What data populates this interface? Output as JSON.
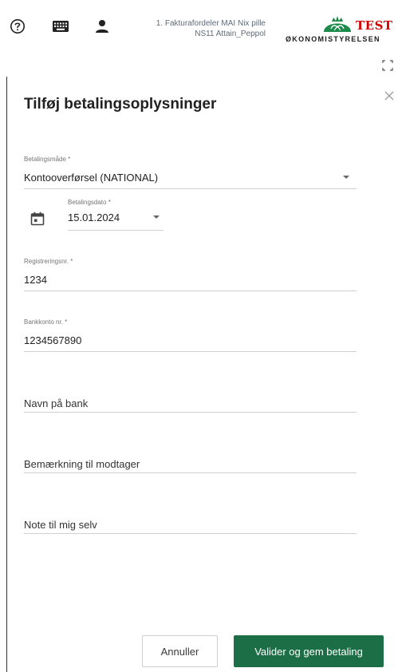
{
  "header": {
    "user_line1": "1. Fakturafordeler MAI Nix pille",
    "user_line2": "NS11 Attain_Peppol",
    "logo_badge": "TEST",
    "logo_name": "ØKONOMISTYRELSEN",
    "icons": [
      "help-icon",
      "keyboard-icon",
      "person-icon"
    ]
  },
  "dialog": {
    "title": "Tilføj betalingsoplysninger",
    "fields": {
      "payment_method": {
        "label": "Betalingsmåde *",
        "value": "Kontooverførsel (NATIONAL)"
      },
      "payment_date": {
        "label": "Betalingsdato *",
        "value": "15.01.2024"
      },
      "registration_no": {
        "label": "Registreringsnr. *",
        "value": "1234"
      },
      "account_no": {
        "label": "Bankkonto nr. *",
        "value": "1234567890"
      },
      "bank_name": {
        "placeholder": "Navn på bank"
      },
      "remark": {
        "placeholder": "Bemærkning til modtager"
      },
      "note": {
        "placeholder": "Note til mig selv"
      }
    },
    "buttons": {
      "cancel": "Annuller",
      "submit": "Valider og gem betaling"
    }
  },
  "colors": {
    "primary": "#1b6e45",
    "logo_green": "#1b8a4a",
    "test_red": "#d40000"
  }
}
